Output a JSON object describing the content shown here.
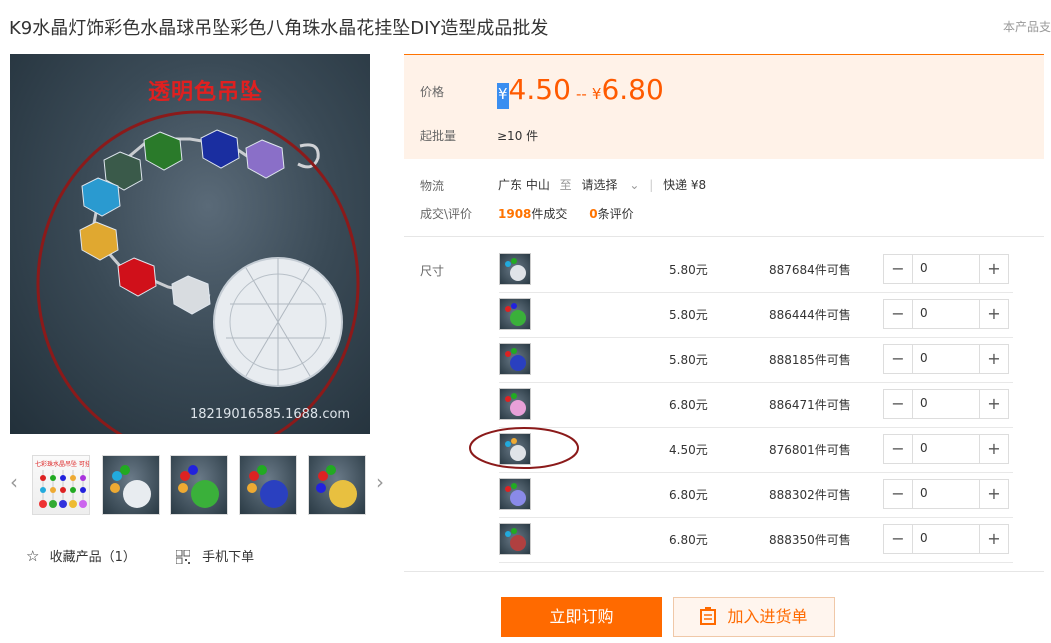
{
  "product": {
    "title": "K9水晶灯饰彩色水晶球吊坠彩色八角珠水晶花挂坠DIY造型成品批发",
    "top_right": "本产品支"
  },
  "gallery": {
    "caption": "透明色吊坠",
    "watermark": "18219016585.1688.com",
    "thumb_caption": "七彩珠水晶吊坠 可挂窗做装饰"
  },
  "actions": {
    "favorite_label": "收藏产品（1）",
    "mobile_label": "手机下单",
    "order_button": "立即订购",
    "cart_button": "加入进货单"
  },
  "price": {
    "label": "价格",
    "currency": "¥",
    "min": "4.50",
    "separator": "--",
    "max": "6.80",
    "moq_label": "起批量",
    "moq_value": "≥10 件"
  },
  "logistics": {
    "label": "物流",
    "from": "广东 中山",
    "to_word": "至",
    "destination": "请选择",
    "express": "快递 ¥8",
    "deal_label": "成交\\评价",
    "deals_count": "1908",
    "deals_unit": "件成交",
    "reviews_count": "0",
    "reviews_unit": "条评价"
  },
  "sku": {
    "label": "尺寸",
    "rows": [
      {
        "price": "5.80元",
        "stock": "887684件可售",
        "qty": "0"
      },
      {
        "price": "5.80元",
        "stock": "886444件可售",
        "qty": "0"
      },
      {
        "price": "5.80元",
        "stock": "888185件可售",
        "qty": "0"
      },
      {
        "price": "6.80元",
        "stock": "886471件可售",
        "qty": "0"
      },
      {
        "price": "4.50元",
        "stock": "876801件可售",
        "qty": "0"
      },
      {
        "price": "6.80元",
        "stock": "888302件可售",
        "qty": "0"
      },
      {
        "price": "6.80元",
        "stock": "888350件可售",
        "qty": "0"
      }
    ]
  },
  "colors": {
    "accent": "#ff6a00",
    "annotation": "#8b1a1a"
  }
}
